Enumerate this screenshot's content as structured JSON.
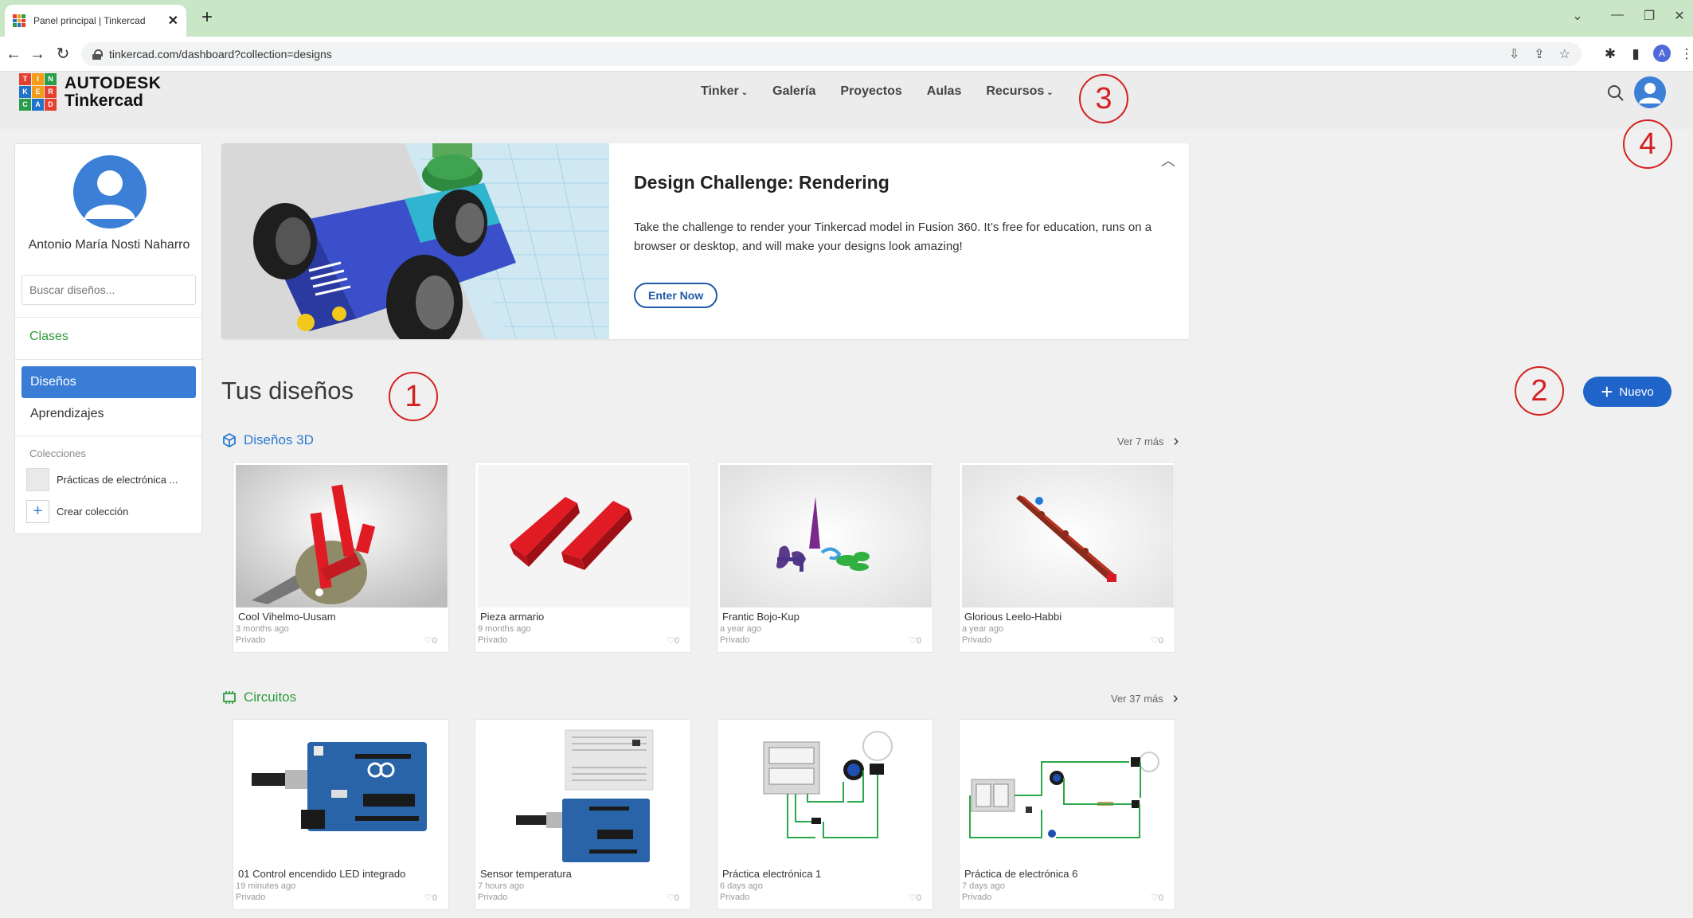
{
  "browser": {
    "tab_title": "Panel principal | Tinkercad",
    "tab_close": "✕",
    "new_tab": "+",
    "url": "tinkercad.com/dashboard?collection=designs",
    "profile_initial": "A"
  },
  "header": {
    "logo_letters": [
      "T",
      "I",
      "N",
      "K",
      "E",
      "R",
      "C",
      "A",
      "D"
    ],
    "logo_colors": [
      "#e5402f",
      "#f49b1a",
      "#2a9d4a",
      "#1f73c8",
      "#f49b1a",
      "#e5402f",
      "#2a9d4a",
      "#1f73c8",
      "#e5402f"
    ],
    "brand_line1": "AUTODESK",
    "brand_line2": "Tinkercad",
    "nav": [
      "Tinker",
      "Galería",
      "Proyectos",
      "Aulas",
      "Recursos"
    ],
    "nav_caret": "⌄"
  },
  "annotations": [
    "1",
    "2",
    "3",
    "4"
  ],
  "sidebar": {
    "user_name": "Antonio María Nosti Naharro",
    "search_placeholder": "Buscar diseños...",
    "clases": "Clases",
    "disenos": "Diseños",
    "aprendizajes": "Aprendizajes",
    "colecciones_title": "Colecciones",
    "collection_item": "Prácticas de electrónica ...",
    "create_collection": "Crear colección",
    "create_plus": "+"
  },
  "banner": {
    "title": "Design Challenge: Rendering",
    "body": "Take the challenge to render your Tinkercad model in Fusion 360. It’s free for education, runs on a browser or desktop, and will make your designs look amazing!",
    "button": "Enter Now",
    "collapse": "︿"
  },
  "main": {
    "title": "Tus diseños",
    "new_button": "Nuevo",
    "new_plus": "+"
  },
  "designs3d": {
    "label": "Diseños 3D",
    "ver_mas": "Ver 7 más",
    "chevron": "›",
    "cards": [
      {
        "title": "Cool Vihelmo-Uusam",
        "time": "3 months ago",
        "privacy": "Privado",
        "likes": "♡0"
      },
      {
        "title": "Pieza armario",
        "time": "9 months ago",
        "privacy": "Privado",
        "likes": "♡0"
      },
      {
        "title": "Frantic Bojo-Kup",
        "time": "a year ago",
        "privacy": "Privado",
        "likes": "♡0"
      },
      {
        "title": "Glorious Leelo-Habbi",
        "time": "a year ago",
        "privacy": "Privado",
        "likes": "♡0"
      }
    ]
  },
  "circuits": {
    "label": "Circuitos",
    "ver_mas": "Ver 37 más",
    "chevron": "›",
    "cards": [
      {
        "title": "01 Control encendido LED integrado",
        "time": "19 minutes ago",
        "privacy": "Privado",
        "likes": "♡0"
      },
      {
        "title": "Sensor temperatura",
        "time": "7 hours ago",
        "privacy": "Privado",
        "likes": "♡0"
      },
      {
        "title": "Práctica electrónica 1",
        "time": "6 days ago",
        "privacy": "Privado",
        "likes": "♡0"
      },
      {
        "title": "Práctica de electrónica 6",
        "time": "7 days ago",
        "privacy": "Privado",
        "likes": "♡0"
      }
    ]
  },
  "colors": {
    "accent_blue": "#1f64c8",
    "sidebar_active": "#3a7dd6",
    "green_link": "#2e9c3c",
    "annotation_red": "#d52020"
  }
}
